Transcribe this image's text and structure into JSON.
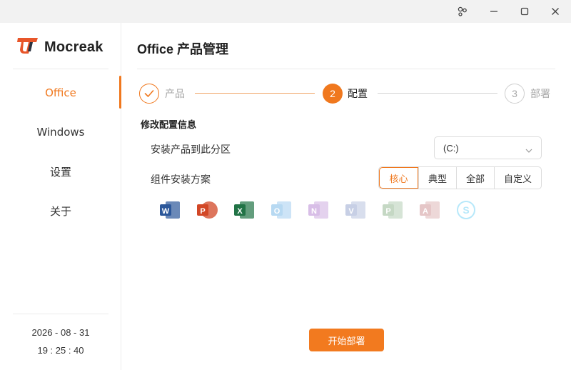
{
  "window": {
    "controls": [
      "settings-icon",
      "minimize-icon",
      "maximize-icon",
      "close-icon"
    ]
  },
  "brand": {
    "name": "Mocreak",
    "logo_color": "#e8562a"
  },
  "sidebar": {
    "items": [
      {
        "label": "Office",
        "active": true
      },
      {
        "label": "Windows",
        "active": false
      },
      {
        "label": "设置",
        "active": false
      },
      {
        "label": "关于",
        "active": false
      }
    ],
    "date": "2026 - 08 - 31",
    "time": "19 : 25 : 40"
  },
  "main": {
    "title": "Office 产品管理",
    "steps": [
      {
        "number": "1",
        "label": "产品",
        "state": "done"
      },
      {
        "number": "2",
        "label": "配置",
        "state": "active"
      },
      {
        "number": "3",
        "label": "部署",
        "state": "todo"
      }
    ],
    "section_title": "修改配置信息",
    "install_partition": {
      "label": "安装产品到此分区",
      "value": "(C:)"
    },
    "component_plan": {
      "label": "组件安装方案",
      "options": [
        "核心",
        "典型",
        "全部",
        "自定义"
      ],
      "selected": "核心"
    },
    "apps": [
      {
        "icon": "word-icon",
        "letter": "W",
        "color": "#2b579a",
        "enabled": true
      },
      {
        "icon": "powerpoint-icon",
        "letter": "P",
        "color": "#d24726",
        "enabled": true
      },
      {
        "icon": "excel-icon",
        "letter": "X",
        "color": "#217346",
        "enabled": true
      },
      {
        "icon": "outlook-icon",
        "letter": "O",
        "color": "#0078d4",
        "enabled": false
      },
      {
        "icon": "onenote-icon",
        "letter": "N",
        "color": "#7719aa",
        "enabled": false
      },
      {
        "icon": "visio-icon",
        "letter": "V",
        "color": "#3955a3",
        "enabled": false
      },
      {
        "icon": "project-icon",
        "letter": "P",
        "color": "#31752f",
        "enabled": false
      },
      {
        "icon": "access-icon",
        "letter": "A",
        "color": "#a4373a",
        "enabled": false
      },
      {
        "icon": "skype-icon",
        "letter": "S",
        "color": "#00aff0",
        "enabled": false
      }
    ],
    "start_button": "开始部署"
  },
  "colors": {
    "accent": "#f0781e",
    "muted": "#a8a8a8"
  }
}
